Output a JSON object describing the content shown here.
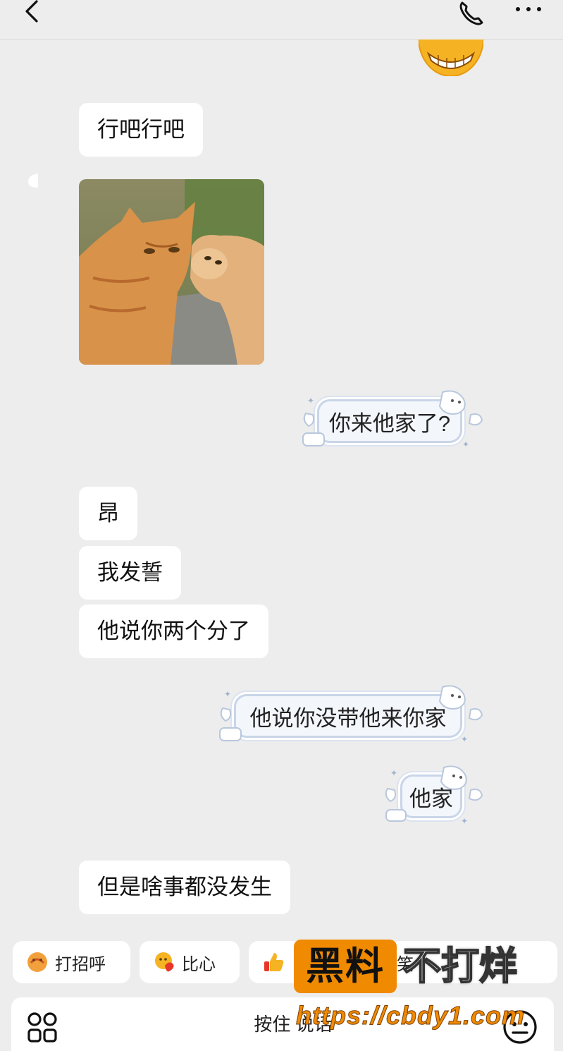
{
  "colors": {
    "background": "#ededed",
    "bubble_in": "#ffffff",
    "bubble_out_fill": "#f3f6fb",
    "bubble_out_border": "#c9d5e8",
    "watermark_orange": "#f08a00"
  },
  "header": {
    "back_icon": "chevron-left-icon",
    "call_icon": "phone-icon",
    "more_icon": "ellipsis-icon"
  },
  "messages": [
    {
      "side": "in",
      "type": "text",
      "text": "行吧行吧"
    },
    {
      "side": "in",
      "type": "image",
      "content": "cat-photo"
    },
    {
      "side": "out",
      "type": "text",
      "text": "你来他家了?"
    },
    {
      "side": "in",
      "type": "text",
      "text": "昂"
    },
    {
      "side": "in",
      "type": "text",
      "text": "我发誓"
    },
    {
      "side": "in",
      "type": "text",
      "text": "他说你两个分了"
    },
    {
      "side": "out",
      "type": "text",
      "text": "他说你没带他来你家"
    },
    {
      "side": "out",
      "type": "text",
      "text": "他家"
    },
    {
      "side": "in",
      "type": "text",
      "text": "但是啥事都没发生"
    }
  ],
  "quick_replies": [
    {
      "label": "打招呼",
      "icon": "wave-hand-icon"
    },
    {
      "label": "比心",
      "icon": "heart-hands-icon"
    },
    {
      "label": "笑",
      "icon": "thumbs-up-icon"
    }
  ],
  "input_bar": {
    "apps_icon": "apps-grid-icon",
    "hold_to_talk": "按住 说话",
    "emoji_icon": "emoji-face-icon"
  },
  "watermark": {
    "box_text": "黑料",
    "side_text": "不打烊",
    "url": "https://cbdy1.com"
  }
}
